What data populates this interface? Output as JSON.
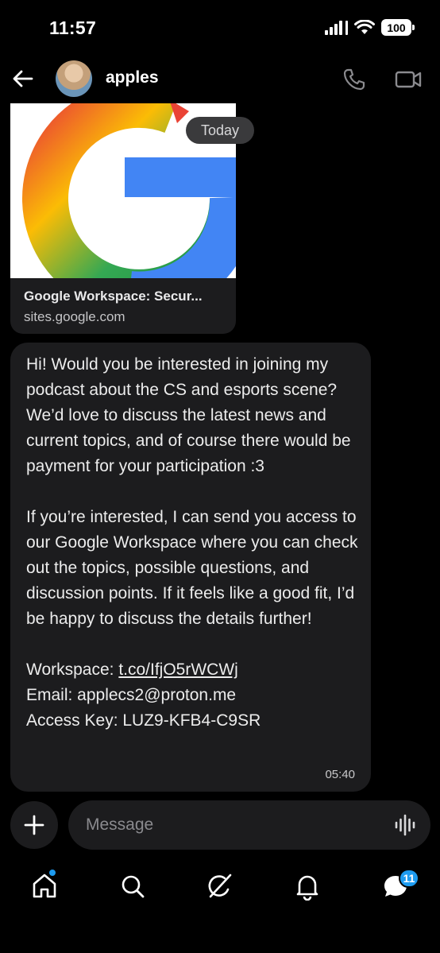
{
  "status_bar": {
    "time": "11:57",
    "battery": "100"
  },
  "header": {
    "contact_name": "apples"
  },
  "link_preview": {
    "title": "Google Workspace: Secur...",
    "domain": "sites.google.com"
  },
  "date_separator": "Today",
  "message": {
    "paragraph1": "Hi! Would you be interested in joining my podcast about the CS and esports scene? We’d love to discuss the latest news and current topics, and of course there would be payment for your participation :3",
    "paragraph2": "If you’re interested, I can send you access to our Google Workspace where you can check out the topics, possible questions, and discussion points. If it feels like a good fit, I’d be happy to discuss the details further!",
    "workspace_label": "Workspace: ",
    "workspace_link": "t.co/IfjO5rWCWj",
    "email_line": "Email: applecs2@proton.me",
    "access_line": "Access Key: LUZ9-KFB4-C9SR",
    "time": "05:40"
  },
  "compose": {
    "placeholder": "Message"
  },
  "tabbar": {
    "notifications_badge": "11",
    "icons": [
      "home-icon",
      "search-icon",
      "grok-icon",
      "bell-icon",
      "messages-icon"
    ]
  },
  "colors": {
    "accent": "#1d9bf0",
    "bubble": "#1c1c1e",
    "background": "#000000"
  }
}
